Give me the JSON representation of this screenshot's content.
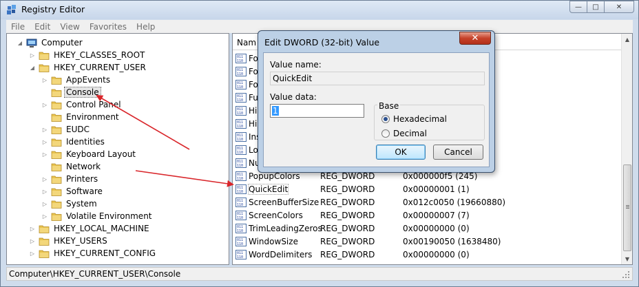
{
  "window": {
    "title": "Registry Editor",
    "minimize_glyph": "—",
    "maximize_glyph": "□",
    "close_glyph": "✕"
  },
  "menu": [
    "File",
    "Edit",
    "View",
    "Favorites",
    "Help"
  ],
  "tree": {
    "items": [
      {
        "label": "Computer",
        "level": 0,
        "expander": "◢",
        "icon": "computer-icon"
      },
      {
        "label": "HKEY_CLASSES_ROOT",
        "level": 1,
        "expander": "▷",
        "icon": "folder-icon"
      },
      {
        "label": "HKEY_CURRENT_USER",
        "level": 1,
        "expander": "◢",
        "icon": "folder-icon"
      },
      {
        "label": "AppEvents",
        "level": 2,
        "expander": "▷",
        "icon": "folder-icon"
      },
      {
        "label": "Console",
        "level": 2,
        "expander": "",
        "icon": "folder-icon",
        "selected": true
      },
      {
        "label": "Control Panel",
        "level": 2,
        "expander": "▷",
        "icon": "folder-icon"
      },
      {
        "label": "Environment",
        "level": 2,
        "expander": "",
        "icon": "folder-icon"
      },
      {
        "label": "EUDC",
        "level": 2,
        "expander": "▷",
        "icon": "folder-icon"
      },
      {
        "label": "Identities",
        "level": 2,
        "expander": "▷",
        "icon": "folder-icon"
      },
      {
        "label": "Keyboard Layout",
        "level": 2,
        "expander": "▷",
        "icon": "folder-icon"
      },
      {
        "label": "Network",
        "level": 2,
        "expander": "",
        "icon": "folder-icon"
      },
      {
        "label": "Printers",
        "level": 2,
        "expander": "▷",
        "icon": "folder-icon"
      },
      {
        "label": "Software",
        "level": 2,
        "expander": "▷",
        "icon": "folder-icon"
      },
      {
        "label": "System",
        "level": 2,
        "expander": "▷",
        "icon": "folder-icon"
      },
      {
        "label": "Volatile Environment",
        "level": 2,
        "expander": "▷",
        "icon": "folder-icon"
      },
      {
        "label": "HKEY_LOCAL_MACHINE",
        "level": 1,
        "expander": "▷",
        "icon": "folder-icon"
      },
      {
        "label": "HKEY_USERS",
        "level": 1,
        "expander": "▷",
        "icon": "folder-icon"
      },
      {
        "label": "HKEY_CURRENT_CONFIG",
        "level": 1,
        "expander": "▷",
        "icon": "folder-icon"
      }
    ]
  },
  "list": {
    "header_name": "Nam",
    "rows": [
      {
        "name": "Fo",
        "type": "",
        "data": ""
      },
      {
        "name": "Fo",
        "type": "",
        "data": ""
      },
      {
        "name": "Fo",
        "type": "",
        "data": ""
      },
      {
        "name": "Ful",
        "type": "",
        "data": ""
      },
      {
        "name": "His",
        "type": "",
        "data": ""
      },
      {
        "name": "His",
        "type": "",
        "data": ""
      },
      {
        "name": "Ins",
        "type": "",
        "data": ""
      },
      {
        "name": "Loa",
        "type": "",
        "data": ""
      },
      {
        "name": "Nu",
        "type": "",
        "data": ""
      },
      {
        "name": "PopupColors",
        "type": "REG_DWORD",
        "data": "0x000000f5 (245)"
      },
      {
        "name": "QuickEdit",
        "type": "REG_DWORD",
        "data": "0x00000001 (1)",
        "selected": true
      },
      {
        "name": "ScreenBufferSize",
        "type": "REG_DWORD",
        "data": "0x012c0050 (19660880)"
      },
      {
        "name": "ScreenColors",
        "type": "REG_DWORD",
        "data": "0x00000007 (7)"
      },
      {
        "name": "TrimLeadingZeros",
        "type": "REG_DWORD",
        "data": "0x00000000 (0)"
      },
      {
        "name": "WindowSize",
        "type": "REG_DWORD",
        "data": "0x00190050 (1638480)"
      },
      {
        "name": "WordDelimiters",
        "type": "REG_DWORD",
        "data": "0x00000000 (0)"
      }
    ],
    "scroll_up_glyph": "▲",
    "scroll_down_glyph": "▼"
  },
  "status": {
    "path": "Computer\\HKEY_CURRENT_USER\\Console"
  },
  "dialog": {
    "title": "Edit DWORD (32-bit) Value",
    "close_glyph": "✕",
    "value_name_label": "Value name:",
    "value_name": "QuickEdit",
    "value_data_label": "Value data:",
    "value_data": "1",
    "base_label": "Base",
    "base_options": [
      {
        "label": "Hexadecimal",
        "checked": true
      },
      {
        "label": "Decimal",
        "checked": false
      }
    ],
    "ok_label": "OK",
    "cancel_label": "Cancel"
  },
  "colors": {
    "annotation_arrow": "#d9262b",
    "selection": "#3399ff",
    "folder": "#e8c34f"
  }
}
